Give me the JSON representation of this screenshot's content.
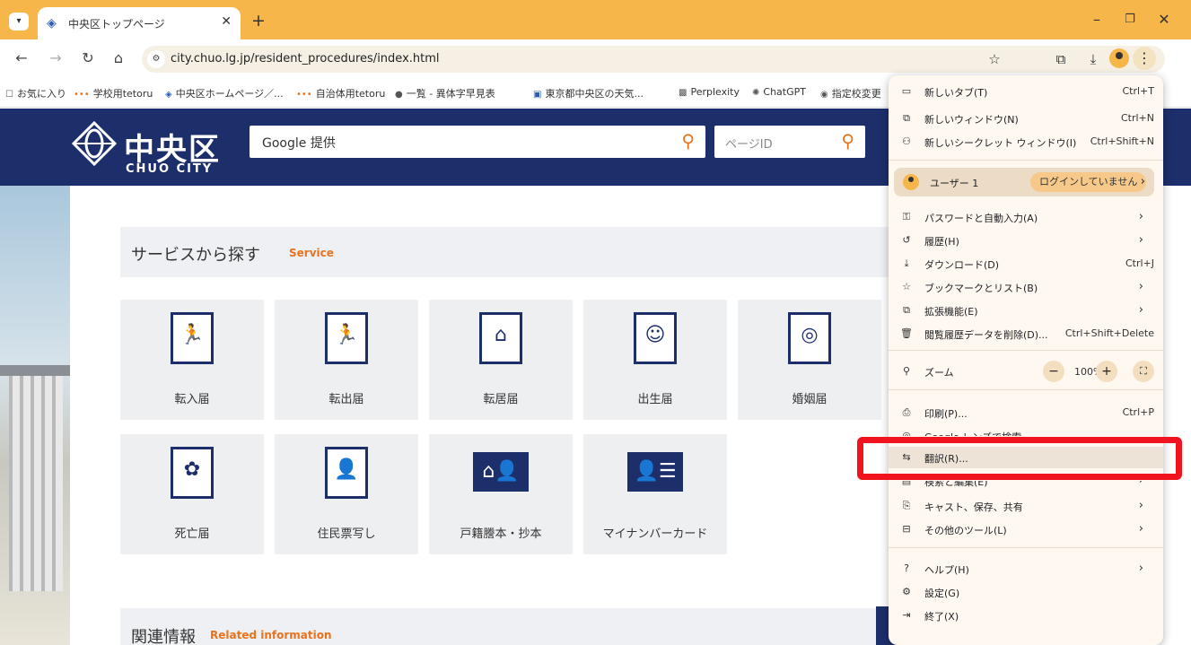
{
  "browser": {
    "tab_title": "中央区トップページ",
    "url": "city.chuo.lg.jp/resident_procedures/index.html",
    "bookmarks": [
      "お気に入り",
      "学校用tetoru",
      "中央区ホームページ／...",
      "自治体用tetoru",
      "一覧 - 異体字早見表",
      "東京都中央区の天気...",
      "Perplexity",
      "ChatGPT",
      "指定校変更"
    ]
  },
  "site": {
    "logo_kanji": "中央区",
    "logo_en": "CHUO CITY",
    "search_placeholder": "Google 提供",
    "page_id_placeholder": "ページID",
    "section_title": "サービスから探す",
    "section_en": "Service",
    "related_title": "関連情報",
    "related_en": "Related information",
    "cards": [
      {
        "label": "転入届",
        "icon": "moving-in-icon"
      },
      {
        "label": "転出届",
        "icon": "moving-out-icon"
      },
      {
        "label": "転居届",
        "icon": "relocation-icon"
      },
      {
        "label": "出生届",
        "icon": "birth-icon"
      },
      {
        "label": "婚姻届",
        "icon": "marriage-icon"
      },
      {
        "label": "死亡届",
        "icon": "death-icon"
      },
      {
        "label": "住民票写し",
        "icon": "resident-record-icon"
      },
      {
        "label": "戸籍謄本・抄本",
        "icon": "family-register-icon"
      },
      {
        "label": "マイナンバーカード",
        "icon": "my-number-card-icon"
      }
    ]
  },
  "menu": {
    "items": [
      {
        "label": "新しいタブ(T)",
        "shortcut": "Ctrl+T"
      },
      {
        "label": "新しいウィンドウ(N)",
        "shortcut": "Ctrl+N"
      },
      {
        "label": "新しいシークレット ウィンドウ(I)",
        "shortcut": "Ctrl+Shift+N"
      }
    ],
    "profile": {
      "name": "ユーザー 1",
      "status": "ログインしていません"
    },
    "items2": [
      {
        "label": "パスワードと自動入力(A)",
        "shortcut": "",
        "arrow": true
      },
      {
        "label": "履歴(H)",
        "shortcut": "",
        "arrow": true
      },
      {
        "label": "ダウンロード(D)",
        "shortcut": "Ctrl+J",
        "arrow": false
      },
      {
        "label": "ブックマークとリスト(B)",
        "shortcut": "",
        "arrow": true
      },
      {
        "label": "拡張機能(E)",
        "shortcut": "",
        "arrow": true
      },
      {
        "label": "閲覧履歴データを削除(D)...",
        "shortcut": "Ctrl+Shift+Delete",
        "arrow": false
      }
    ],
    "zoom": {
      "label": "ズーム",
      "value": "100%"
    },
    "items3": [
      {
        "label": "印刷(P)...",
        "shortcut": "Ctrl+P",
        "arrow": false
      },
      {
        "label": "Google レンズで検索",
        "shortcut": "",
        "arrow": false
      },
      {
        "label": "翻訳(R)...",
        "shortcut": "",
        "arrow": false
      },
      {
        "label": "検索と編集(E)",
        "shortcut": "",
        "arrow": true
      },
      {
        "label": "キャスト、保存、共有",
        "shortcut": "",
        "arrow": true
      },
      {
        "label": "その他のツール(L)",
        "shortcut": "",
        "arrow": true
      }
    ],
    "items4": [
      {
        "label": "ヘルプ(H)",
        "shortcut": "",
        "arrow": true
      },
      {
        "label": "設定(G)",
        "shortcut": "",
        "arrow": false
      },
      {
        "label": "終了(X)",
        "shortcut": "",
        "arrow": false
      }
    ]
  },
  "colors": {
    "tab_strip": "#f7b64a",
    "site_navy": "#1d2f6b",
    "accent_orange": "#e8731c",
    "highlight_red": "#f0141e"
  }
}
